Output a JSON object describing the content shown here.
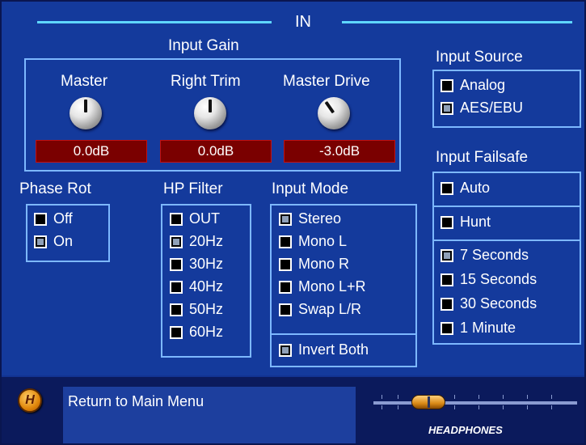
{
  "header": {
    "title": "IN"
  },
  "input_gain": {
    "label": "Input Gain",
    "knobs": [
      {
        "label": "Master",
        "value": "0.0dB"
      },
      {
        "label": "Right Trim",
        "value": "0.0dB"
      },
      {
        "label": "Master Drive",
        "value": "-3.0dB"
      }
    ]
  },
  "input_source": {
    "label": "Input Source",
    "options": [
      {
        "label": "Analog",
        "checked": false
      },
      {
        "label": "AES/EBU",
        "checked": true
      }
    ]
  },
  "input_failsafe": {
    "label": "Input Failsafe",
    "modes": [
      {
        "label": "Auto",
        "checked": false
      },
      {
        "label": "Hunt",
        "checked": false
      }
    ],
    "times": [
      {
        "label": "7 Seconds",
        "checked": true
      },
      {
        "label": "15 Seconds",
        "checked": false
      },
      {
        "label": "30 Seconds",
        "checked": false
      },
      {
        "label": "1 Minute",
        "checked": false
      }
    ]
  },
  "phase_rot": {
    "label": "Phase Rot",
    "options": [
      {
        "label": "Off",
        "checked": false
      },
      {
        "label": "On",
        "checked": true
      }
    ]
  },
  "hp_filter": {
    "label": "HP Filter",
    "options": [
      {
        "label": "OUT",
        "checked": false
      },
      {
        "label": "20Hz",
        "checked": true
      },
      {
        "label": "30Hz",
        "checked": false
      },
      {
        "label": "40Hz",
        "checked": false
      },
      {
        "label": "50Hz",
        "checked": false
      },
      {
        "label": "60Hz",
        "checked": false
      }
    ]
  },
  "input_mode": {
    "label": "Input Mode",
    "options": [
      {
        "label": "Stereo",
        "checked": true
      },
      {
        "label": "Mono L",
        "checked": false
      },
      {
        "label": "Mono R",
        "checked": false
      },
      {
        "label": "Mono L+R",
        "checked": false
      },
      {
        "label": "Swap L/R",
        "checked": false
      }
    ],
    "invert": {
      "label": "Invert Both",
      "checked": true
    }
  },
  "footer": {
    "home_icon_letter": "H",
    "message": "Return to Main Menu",
    "headphones_label": "HEADPHONES",
    "headphones_level_percent": 25
  },
  "colors": {
    "background": "#143a9c",
    "accent_line": "#5fd7ff",
    "readout_bg": "#7a0000",
    "box_border": "#7db8ff"
  }
}
